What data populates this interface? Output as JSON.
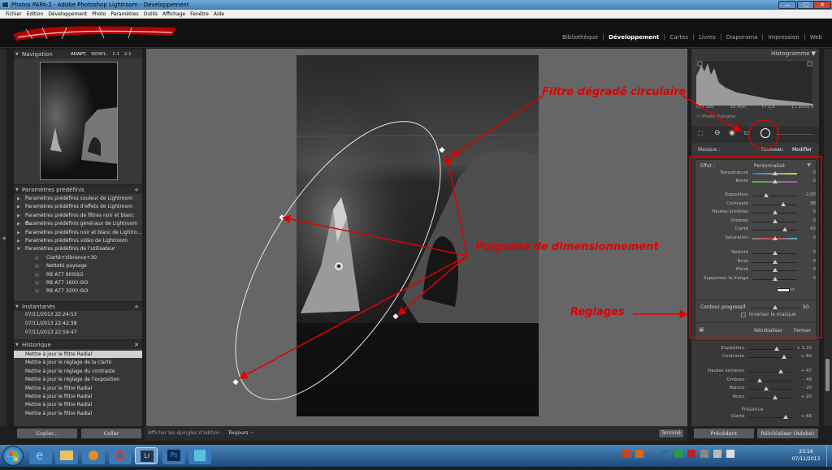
{
  "window": {
    "title": "Photos PAPA-2 - Adobe Photoshop Lightroom - Développement",
    "buttons": [
      "—",
      "□",
      "✕"
    ]
  },
  "menu": [
    "Fichier",
    "Edition",
    "Développement",
    "Photo",
    "Paramètres",
    "Outils",
    "Affichage",
    "Fenêtre",
    "Aide"
  ],
  "modules": [
    "Bibliothèque",
    "Développement",
    "Cartes",
    "Livres",
    "Diaporama",
    "Impression",
    "Web"
  ],
  "active_module": "Développement",
  "left_panel": {
    "navigator": {
      "title": "Navigation",
      "zoom_options": [
        "ADAPT.",
        "REMPL.",
        "1:1",
        "2:1"
      ]
    },
    "presets": {
      "title": "Paramètres prédéfinis",
      "items": [
        "Paramètres prédéfinis couleur de Lightroom",
        "Paramètres prédéfinis d'effets de Lightroom",
        "Paramètres prédéfinis de filtres noir et blanc d...",
        "Paramètres prédéfinis généraux de Lightroom",
        "Paramètres prédéfinis noir et blanc de Lightro...",
        "Paramètres prédéfinis vidéo de Lightroom",
        "Paramètres prédéfinis de l'utilisateur"
      ],
      "user_items": [
        "Clarté+Vibrance+30",
        "Netteté paysage",
        "RB A77 800ISO",
        "RB A77 1600 ISO",
        "RB A77 3200 ISO"
      ]
    },
    "snapshots": {
      "title": "Instantanés",
      "items": [
        "07/11/2013 22:24:53",
        "07/11/2013 22:42:38",
        "07/11/2013 22:59:47"
      ]
    },
    "history": {
      "title": "Historique",
      "items": [
        "Mettre à jour le filtre Radial",
        "Mettre à jour le réglage de la clarté",
        "Mettre à jour le réglage du contraste",
        "Mettre à jour le réglage de l'exposition",
        "Mettre à jour le filtre Radial",
        "Mettre à jour le filtre Radial",
        "Mettre à jour le filtre Radial",
        "Mettre à jour le filtre Radial"
      ]
    },
    "copy_button": "Copier...",
    "paste_button": "Coller"
  },
  "toolbar": {
    "label": "Afficher les épingles d'édition :",
    "value": "Toujours",
    "done_button": "Terminé"
  },
  "right_panel": {
    "histogram_title": "Histogramme",
    "exif": [
      "ISO 100",
      "55 mm",
      "f / 3,6",
      "1 / 2000 s"
    ],
    "original_photo_label": "Photo d'origine",
    "mask_label": "Masque :",
    "mask_new": "Nouveau",
    "mask_edit": "Modifier",
    "effect_label": "Effet :",
    "effect_value": "Personnalisé",
    "sliders_a": [
      {
        "label": "Température",
        "value": "0",
        "pos": 0.5,
        "color": "temp"
      },
      {
        "label": "Teinte",
        "value": "0",
        "pos": 0.5,
        "color": "tint"
      }
    ],
    "sliders_b": [
      {
        "label": "Exposition",
        "value": "- 2,00",
        "pos": 0.3
      },
      {
        "label": "Contraste",
        "value": "38",
        "pos": 0.69
      },
      {
        "label": "Hautes lumières",
        "value": "0",
        "pos": 0.5
      },
      {
        "label": "Ombres",
        "value": "0",
        "pos": 0.5
      },
      {
        "label": "Clarté",
        "value": "43",
        "pos": 0.72
      },
      {
        "label": "Saturation",
        "value": "0",
        "pos": 0.5,
        "color": "sat"
      }
    ],
    "sliders_c": [
      {
        "label": "Netteté",
        "value": "0",
        "pos": 0.5
      },
      {
        "label": "Bruit",
        "value": "0",
        "pos": 0.5
      },
      {
        "label": "Moiré",
        "value": "0",
        "pos": 0.5
      },
      {
        "label": "Supprimer la frange",
        "value": "0",
        "pos": 0.5
      }
    ],
    "color_label": "Couleur",
    "feather_label": "Contour progressif",
    "feather_value": "50",
    "feather_pos": 0.5,
    "invert_label": "Inverser le masque",
    "reset_label": "Réinitialiser",
    "close_label": "Fermer",
    "basic_sliders": [
      {
        "label": "Exposition",
        "value": "+ 1,33",
        "pos": 0.63
      },
      {
        "label": "Contraste",
        "value": "+ 60",
        "pos": 0.8
      },
      {
        "label": "Hautes lumières",
        "value": "+ 47",
        "pos": 0.73
      },
      {
        "label": "Ombres",
        "value": "- 49",
        "pos": 0.26
      },
      {
        "label": "Blancs",
        "value": "- 20",
        "pos": 0.4
      },
      {
        "label": "Noirs",
        "value": "+ 20",
        "pos": 0.6
      }
    ],
    "presence_label": "Présence",
    "basic_clarity": {
      "label": "Clarté",
      "value": "+ 68",
      "pos": 0.84
    },
    "prev_button": "Précédent",
    "reset_adobe_button": "Réinitialiser (Adobe)"
  },
  "annotations": {
    "radial": "Filtre dégradé circulaire",
    "handles": "Poignées de dimensionnement",
    "settings": "Reglages"
  },
  "taskbar": {
    "time": "23:16",
    "date": "07/11/2013"
  }
}
